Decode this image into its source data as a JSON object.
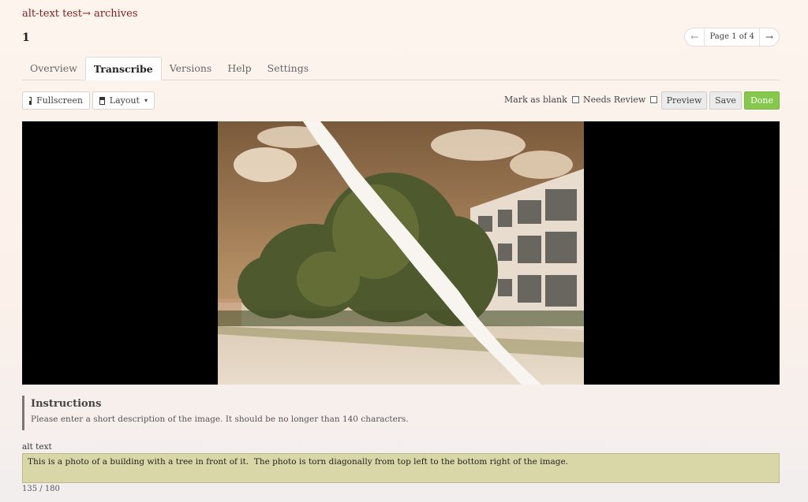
{
  "breadcrumb": {
    "project": "alt-text test",
    "arrow": "→",
    "section": "archives"
  },
  "page_title": "1",
  "pager": {
    "prev": "←",
    "label": "Page 1 of 4",
    "next": "→"
  },
  "tabs": [
    {
      "label": "Overview",
      "active": false
    },
    {
      "label": "Transcribe",
      "active": true
    },
    {
      "label": "Versions",
      "active": false
    },
    {
      "label": "Help",
      "active": false
    },
    {
      "label": "Settings",
      "active": false
    }
  ],
  "toolbar": {
    "fullscreen": "Fullscreen",
    "layout": "Layout",
    "layout_caret": "▾",
    "mark_blank": "Mark as blank",
    "needs_review": "Needs Review",
    "preview": "Preview",
    "save": "Save",
    "done": "Done"
  },
  "instructions": {
    "title": "Instructions",
    "text": "Please enter a short description of the image. It should be no longer than 140 characters."
  },
  "field": {
    "label": "alt text",
    "value": "This is a photo of a building with a tree in front of it.  The photo is torn diagonally from top left to the bottom right of the image.",
    "counter": "135 / 180"
  },
  "colors": {
    "accent": "#8b1a1a",
    "done": "#86c84e",
    "input_bg": "#d9d6a8"
  }
}
